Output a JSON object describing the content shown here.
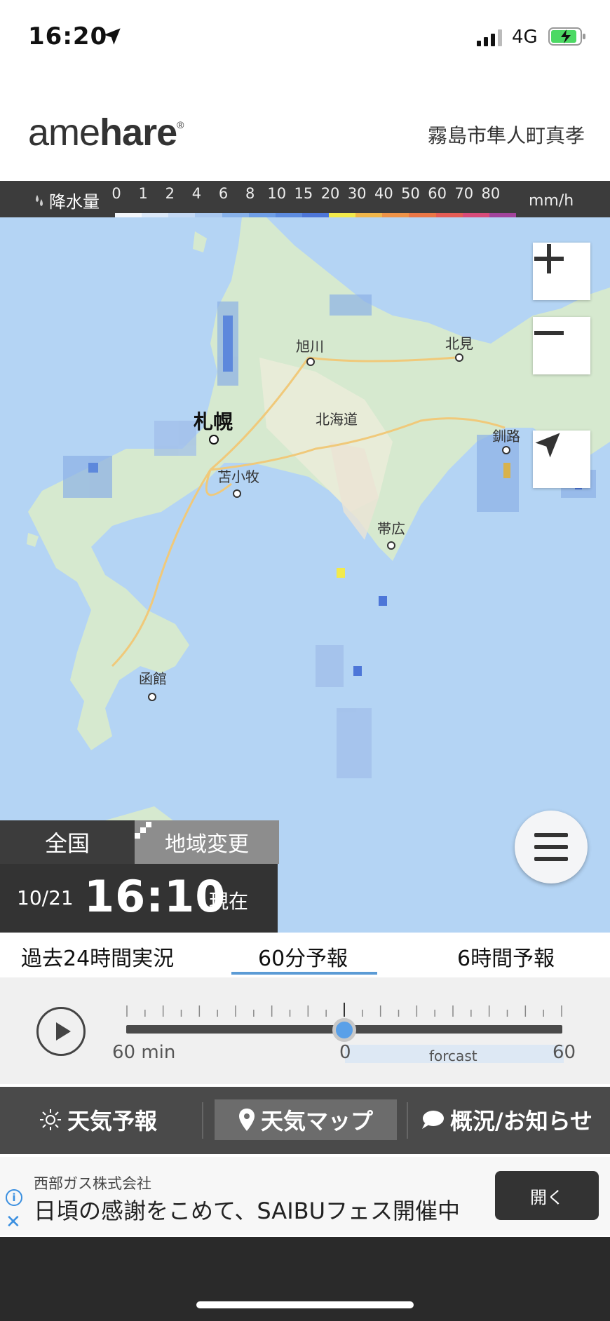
{
  "status_bar": {
    "time": "16:20",
    "network": "4G"
  },
  "header": {
    "logo_light": "ame",
    "logo_bold": "hare",
    "logo_mark": "®",
    "location": "霧島市隼人町真孝"
  },
  "legend": {
    "label": "降水量",
    "values": [
      "0",
      "1",
      "2",
      "4",
      "6",
      "8",
      "10",
      "15",
      "20",
      "30",
      "40",
      "50",
      "60",
      "70",
      "80"
    ],
    "colors": [
      "#f2f6fb",
      "#dbe8f8",
      "#c4d9f4",
      "#a9c8ef",
      "#88b2ea",
      "#6f9fe6",
      "#5d8ce0",
      "#4d76d8",
      "#f2ea4c",
      "#f0b64a",
      "#ee9348",
      "#ea7646",
      "#e45c56",
      "#d84b7a",
      "#a2449c"
    ],
    "unit": "mm/h"
  },
  "map": {
    "cities": [
      {
        "name": "旭川",
        "big": false
      },
      {
        "name": "北見",
        "big": false
      },
      {
        "name": "札幌",
        "big": true
      },
      {
        "name": "北海道",
        "big": false
      },
      {
        "name": "帯広",
        "big": false
      },
      {
        "name": "釧路",
        "big": false
      },
      {
        "name": "苫小牧",
        "big": false
      },
      {
        "name": "函館",
        "big": false
      }
    ],
    "controls": {
      "zoom_in": "+",
      "zoom_out": "−"
    }
  },
  "region": {
    "all": "全国",
    "change": "地域変更"
  },
  "time_box": {
    "date": "10/21",
    "time": "16:10",
    "now": "現在"
  },
  "tabs": [
    {
      "label": "過去24時間実況",
      "active": false
    },
    {
      "label": "60分予報",
      "active": true
    },
    {
      "label": "6時間予報",
      "active": false
    }
  ],
  "player": {
    "start_label": "60 min",
    "zero_label": "0",
    "forecast_label": "forcast",
    "end_label": "60",
    "position_fraction": 0.5
  },
  "bottom_nav": [
    {
      "label": "天気予報",
      "icon": "sun-icon",
      "active": false
    },
    {
      "label": "天気マップ",
      "icon": "map-pin-icon",
      "active": true
    },
    {
      "label": "概況/お知らせ",
      "icon": "speech-bubble-icon",
      "active": false
    }
  ],
  "ad": {
    "sponsor": "西部ガス株式会社",
    "text": "日頃の感謝をこめて、SAIBUフェス開催中",
    "button": "開く"
  }
}
